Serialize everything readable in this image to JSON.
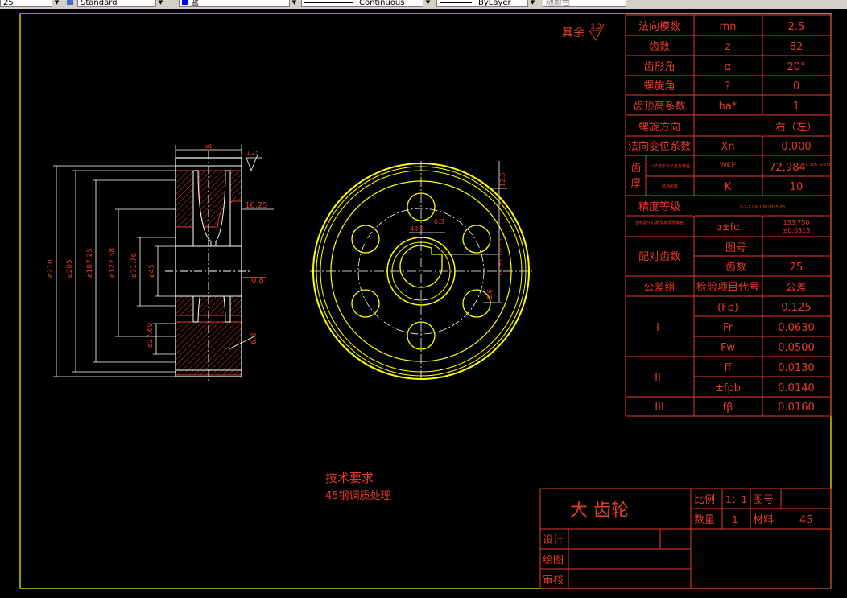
{
  "toolbar": {
    "layer_value": "25",
    "style_value": "Standard",
    "color_value": "蓝",
    "linetype_value": "Continuous",
    "lineweight_value": "ByLayer",
    "plotstyle_value": "随颜色"
  },
  "roughness": {
    "label": "其余",
    "value": "3.2"
  },
  "params": [
    {
      "name": "法向模数",
      "symbol": "mn",
      "value": "2.5"
    },
    {
      "name": "齿数",
      "symbol": "z",
      "value": "82"
    },
    {
      "name": "齿形角",
      "symbol": "α",
      "value": "20°"
    },
    {
      "name": "螺旋角",
      "symbol": "?",
      "value": "0"
    },
    {
      "name": "齿顶高系数",
      "symbol": "ha*",
      "value": "1"
    },
    {
      "name": "螺旋方向",
      "symbol": "",
      "value": "右（左）"
    },
    {
      "name": "法向变位系数",
      "symbol": "Xn",
      "value": "0.000"
    }
  ],
  "thickness": {
    "label_1": "齿",
    "label_2": "厚",
    "row1_desc": "公法线平均长度及偏差",
    "row1_symbol": "WKE",
    "row1_value": "72.984",
    "row1_tol": "-0.106 -0.198",
    "row2_desc": "跨测齿数",
    "row2_symbol": "K",
    "row2_value": "10"
  },
  "precision": {
    "name": "精度等级",
    "value": "8-7-7 GM GB10095-88"
  },
  "center": {
    "name": "齿轮副中心距及其极限偏差",
    "symbol": "α±fα",
    "value": "133.750",
    "tol": "±0.0315"
  },
  "mating": {
    "name": "配对齿数",
    "drawing_label": "图号",
    "teeth_label": "齿数",
    "teeth_value": "25"
  },
  "tolerance_header": {
    "group": "公差组",
    "code": "检验项目代号",
    "tol": "公差"
  },
  "tolerances": [
    {
      "group": "I",
      "code": "(Fp)",
      "value": "0.125"
    },
    {
      "group": "",
      "code": "Fr",
      "value": "0.0630"
    },
    {
      "group": "",
      "code": "Fw",
      "value": "0.0500"
    },
    {
      "group": "II",
      "code": "ff",
      "value": "0.0130"
    },
    {
      "group": "",
      "code": "±fpb",
      "value": "0.0140"
    },
    {
      "group": "III",
      "code": "fβ",
      "value": "0.0160"
    }
  ],
  "notes": {
    "title": "技术要求",
    "line1": "45钢调质处理"
  },
  "title_block": {
    "part_name": "大 齿轮",
    "scale_label": "比例",
    "scale_value": "1：1",
    "drawing_no_label": "图号",
    "qty_label": "数量",
    "qty_value": "1",
    "material_label": "材料",
    "material_value": "45",
    "design_label": "设计",
    "draw_label": "绘图",
    "review_label": "审核"
  },
  "dims": {
    "d210": "ø210",
    "d205": "ø205",
    "d187": "ø187.25",
    "d127": "ø127.38",
    "d71": "ø71.76",
    "d45": "ø45",
    "d27": "ø27.69",
    "width": "ø1",
    "chamfer": "1.25",
    "hub": "16.25",
    "r08": "0.8",
    "r68": "6.8",
    "key_w": "48.8",
    "key_t": "6.3",
    "keyway": "14 ±0.0215",
    "r36": "3.6",
    "r125": "12.5"
  },
  "colors": {
    "red": "#e53a2a",
    "yellow": "#ffff00",
    "background": "#000000",
    "frame": "#ffff00"
  }
}
